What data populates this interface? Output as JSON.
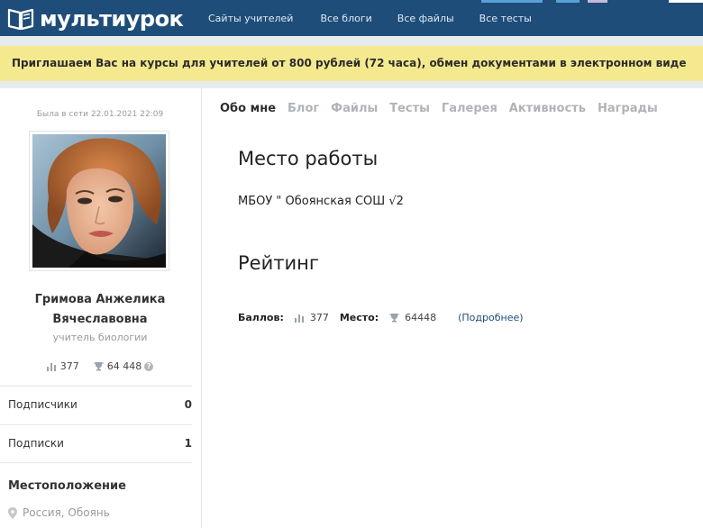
{
  "header": {
    "logo_text": "мультиурок",
    "nav": [
      "Сайты учителей",
      "Все блоги",
      "Все файлы",
      "Все тесты"
    ],
    "bg_color": "#1e4d79"
  },
  "banner": {
    "text": "Приглашаем Вас на курсы для учителей от 800 рублей (72 часа), обмен документами в электронном виде",
    "bg_color": "#f5e98f"
  },
  "sidebar": {
    "last_seen": "Была в сети 22.01.2021 22:09",
    "name_line1": "Гримова Анжелика",
    "name_line2": "Вячеславовна",
    "role": "учитель биологии",
    "points": "377",
    "place": "64 448",
    "help_icon": "question-icon",
    "rows": [
      {
        "label": "Подписчики",
        "count": "0"
      },
      {
        "label": "Подписки",
        "count": "1"
      }
    ],
    "location_title": "Местоположение",
    "location_value": "Россия, Обоянь"
  },
  "tabs": [
    {
      "label": "Обо мне",
      "active": true
    },
    {
      "label": "Блог",
      "active": false
    },
    {
      "label": "Файлы",
      "active": false
    },
    {
      "label": "Тесты",
      "active": false
    },
    {
      "label": "Галерея",
      "active": false
    },
    {
      "label": "Активность",
      "active": false
    },
    {
      "label": "Награды",
      "active": false
    }
  ],
  "main": {
    "workplace_title": "Место работы",
    "workplace_value": "МБОУ \" Обоянская СОШ √2",
    "rating_title": "Рейтинг",
    "points_label": "Баллов:",
    "points_value": "377",
    "place_label": "Место:",
    "place_value": "64448",
    "more_link": "(Подробнее)"
  }
}
